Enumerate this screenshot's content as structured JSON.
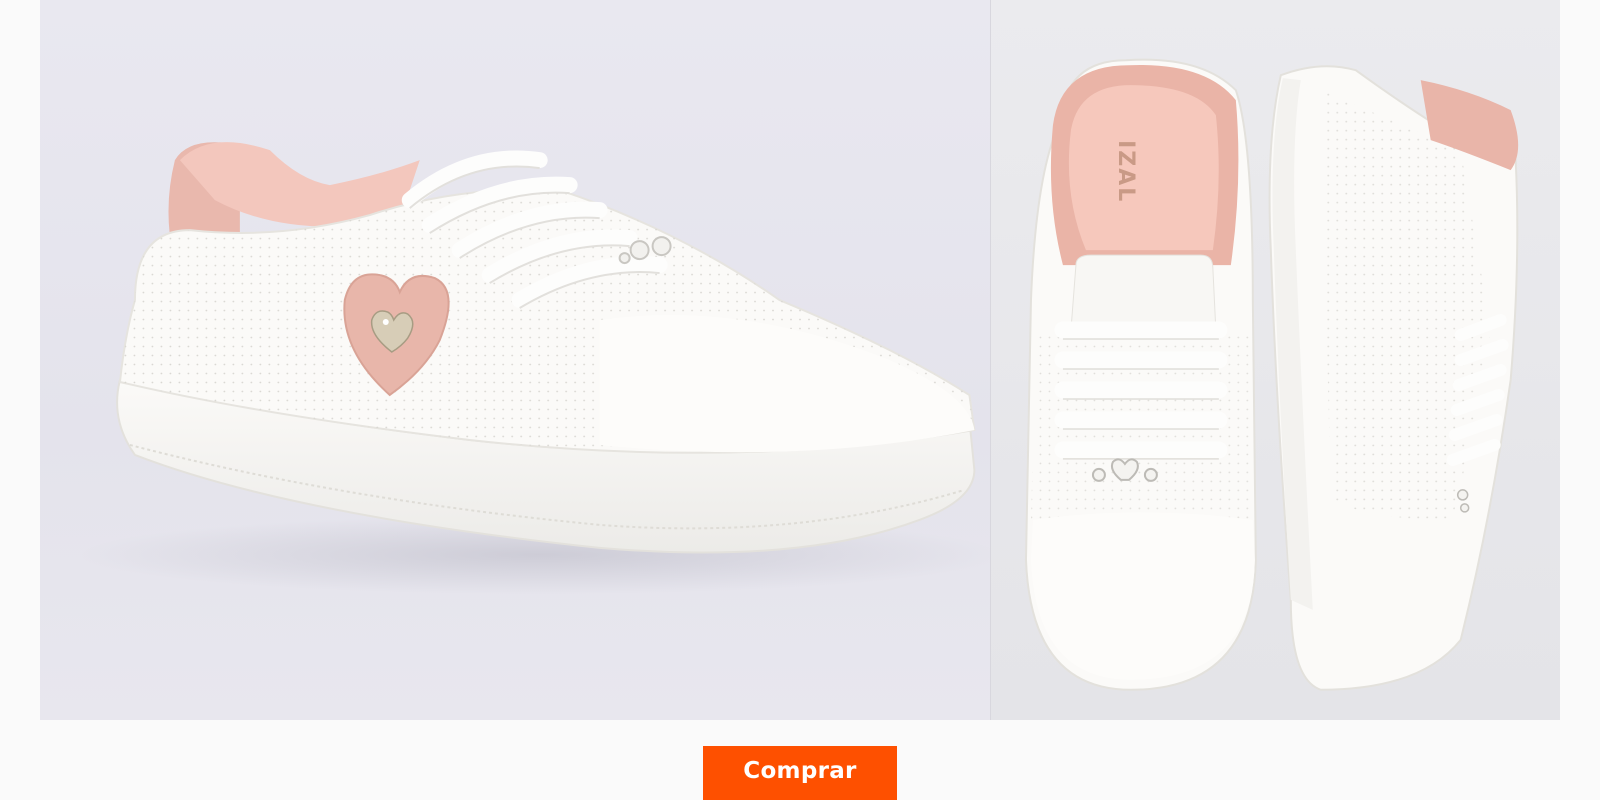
{
  "product": {
    "images": [
      {
        "alt": "",
        "view": "side-angle"
      },
      {
        "alt": "",
        "view": "top-and-side-pair"
      }
    ],
    "insole_print": "IZAL",
    "colors": {
      "upper": "#fbfaf8",
      "sole": "#f4f3f0",
      "accent_pink": "#e7b5a9",
      "lining_pink": "#f2c3b8",
      "background": "#e7e6ee"
    }
  },
  "cta": {
    "buy_label": "Comprar",
    "color": "#fe5000"
  }
}
